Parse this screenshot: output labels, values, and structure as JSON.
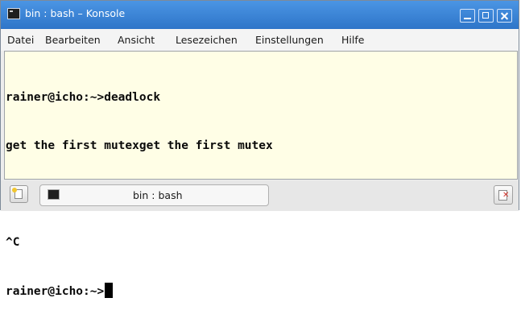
{
  "window": {
    "title": "bin : bash – Konsole",
    "app_icon": "terminal-icon",
    "controls": [
      "minimize-icon",
      "maximize-icon",
      "close-icon"
    ]
  },
  "menubar": {
    "items": [
      "Datei",
      "Bearbeiten",
      "Ansicht",
      "Lesezeichen",
      "Einstellungen",
      "Hilfe"
    ]
  },
  "terminal": {
    "lines": [
      "rainer@icho:~>deadlock",
      "get the first mutexget the first mutex",
      "",
      "^C",
      "rainer@icho:~>"
    ],
    "background": "#fffee6",
    "foreground": "#0a0a0a"
  },
  "tabbar": {
    "new_tab_icon": "new-tab-icon",
    "tab_icon": "terminal-icon",
    "tab_label": "bin : bash",
    "close_tab_icon": "close-tab-icon"
  },
  "colors": {
    "titlebar": "#3c86d8",
    "accent": "#2e75c8"
  }
}
